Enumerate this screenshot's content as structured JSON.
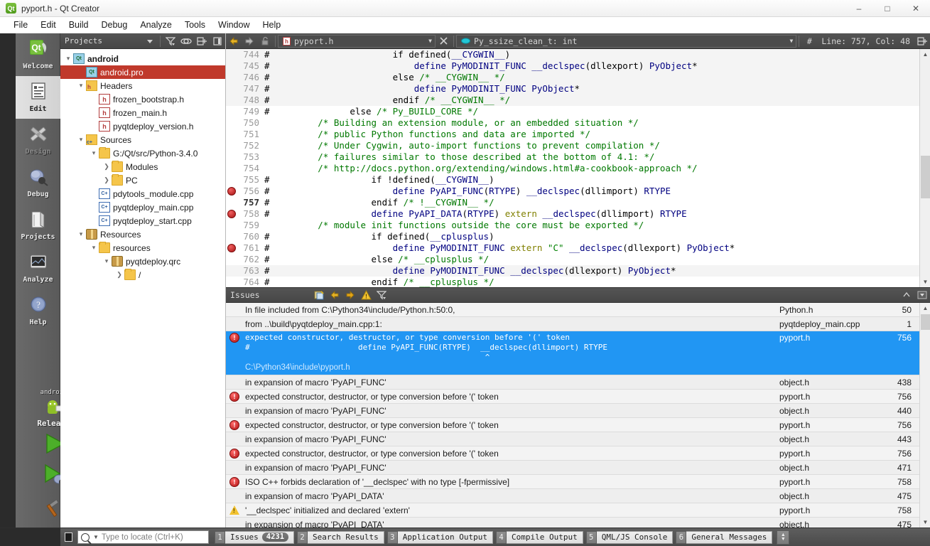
{
  "window": {
    "title": "pyport.h - Qt Creator",
    "app_icon": "qt-logo-icon",
    "minimize": "–",
    "maximize": "□",
    "close": "✕"
  },
  "menubar": {
    "items": [
      "File",
      "Edit",
      "Build",
      "Debug",
      "Analyze",
      "Tools",
      "Window",
      "Help"
    ]
  },
  "modebar": {
    "modes": [
      {
        "label": "Welcome",
        "icon": "qt-welcome-icon",
        "state": "normal"
      },
      {
        "label": "Edit",
        "icon": "document-edit-icon",
        "state": "active"
      },
      {
        "label": "Design",
        "icon": "design-ruler-pencil-icon",
        "state": "disabled"
      },
      {
        "label": "Debug",
        "icon": "bug-icon",
        "state": "normal"
      },
      {
        "label": "Projects",
        "icon": "projects-book-icon",
        "state": "normal"
      },
      {
        "label": "Analyze",
        "icon": "analyze-chart-icon",
        "state": "normal"
      },
      {
        "label": "Help",
        "icon": "help-question-icon",
        "state": "normal"
      }
    ],
    "kit": {
      "target": "android",
      "build_config": "Release",
      "selector_icon": "android-robot-icon",
      "run_icon": "run-green-arrow-icon",
      "debug_icon": "debug-start-icon",
      "build_icon": "build-hammer-icon"
    }
  },
  "projects_pane": {
    "title": "Projects",
    "toolbar_icons": [
      "filter-icon",
      "link-sync-icon",
      "split-add-icon",
      "close-sidebar-icon"
    ],
    "dropdown_icon": "chevron-down-icon",
    "tree": [
      {
        "depth": 0,
        "label": "android",
        "icon": "qt-project-icon",
        "arrow": "open",
        "bold": true,
        "selected": false
      },
      {
        "depth": 1,
        "label": "android.pro",
        "icon": "qt-project-icon",
        "arrow": "none",
        "bold": false,
        "selected": true
      },
      {
        "depth": 1,
        "label": "Headers",
        "icon": "folder-h-icon",
        "arrow": "open",
        "bold": false,
        "selected": false
      },
      {
        "depth": 2,
        "label": "frozen_bootstrap.h",
        "icon": "header-file-icon",
        "arrow": "none",
        "bold": false,
        "selected": false
      },
      {
        "depth": 2,
        "label": "frozen_main.h",
        "icon": "header-file-icon",
        "arrow": "none",
        "bold": false,
        "selected": false
      },
      {
        "depth": 2,
        "label": "pyqtdeploy_version.h",
        "icon": "header-file-icon",
        "arrow": "none",
        "bold": false,
        "selected": false
      },
      {
        "depth": 1,
        "label": "Sources",
        "icon": "folder-cpp-icon",
        "arrow": "open",
        "bold": false,
        "selected": false
      },
      {
        "depth": 2,
        "label": "G:/Qt/src/Python-3.4.0",
        "icon": "folder-icon",
        "arrow": "open",
        "bold": false,
        "selected": false
      },
      {
        "depth": 3,
        "label": "Modules",
        "icon": "folder-icon",
        "arrow": "closed",
        "bold": false,
        "selected": false
      },
      {
        "depth": 3,
        "label": "PC",
        "icon": "folder-icon",
        "arrow": "closed",
        "bold": false,
        "selected": false
      },
      {
        "depth": 2,
        "label": "pdytools_module.cpp",
        "icon": "cpp-file-icon",
        "arrow": "none",
        "bold": false,
        "selected": false
      },
      {
        "depth": 2,
        "label": "pyqtdeploy_main.cpp",
        "icon": "cpp-file-icon",
        "arrow": "none",
        "bold": false,
        "selected": false
      },
      {
        "depth": 2,
        "label": "pyqtdeploy_start.cpp",
        "icon": "cpp-file-icon",
        "arrow": "none",
        "bold": false,
        "selected": false
      },
      {
        "depth": 1,
        "label": "Resources",
        "icon": "resource-icon",
        "arrow": "open",
        "bold": false,
        "selected": false
      },
      {
        "depth": 2,
        "label": "resources",
        "icon": "folder-icon",
        "arrow": "open",
        "bold": false,
        "selected": false
      },
      {
        "depth": 3,
        "label": "pyqtdeploy.qrc",
        "icon": "resource-icon",
        "arrow": "open",
        "bold": false,
        "selected": false
      },
      {
        "depth": 4,
        "label": "/",
        "icon": "folder-icon",
        "arrow": "closed",
        "bold": false,
        "selected": false
      }
    ]
  },
  "editor_toolbar": {
    "back_icon": "arrow-back-icon",
    "forward_icon": "arrow-forward-icon",
    "lock_icon": "unlocked-padlock-icon",
    "file_icon": "header-file-icon",
    "filename": "pyport.h",
    "file_chevron": "chevron-down-icon",
    "close_icon": "close-x-icon",
    "symbol_icon": "symbol-variable-icon",
    "symbol": "Py_ssize_clean_t: int",
    "symbol_chevron": "chevron-down-icon",
    "hash_icon": "hash-icon",
    "cursor_position": "Line: 757, Col: 48",
    "split_icon": "split-add-icon"
  },
  "editor": {
    "lines": [
      {
        "n": "744",
        "bp": false,
        "shade": true,
        "text": "#                       if defined(__CYGWIN__)"
      },
      {
        "n": "745",
        "bp": false,
        "shade": true,
        "text": "#                           define PyMODINIT_FUNC __declspec(dllexport) PyObject*"
      },
      {
        "n": "746",
        "bp": false,
        "shade": true,
        "text": "#                       else /* __CYGWIN__ */"
      },
      {
        "n": "747",
        "bp": false,
        "shade": true,
        "text": "#                           define PyMODINIT_FUNC PyObject*"
      },
      {
        "n": "748",
        "bp": false,
        "shade": true,
        "text": "#                       endif /* __CYGWIN__ */"
      },
      {
        "n": "749",
        "bp": false,
        "shade": false,
        "text": "#               else /* Py_BUILD_CORE */"
      },
      {
        "n": "750",
        "bp": false,
        "shade": false,
        "text": "          /* Building an extension module, or an embedded situation */"
      },
      {
        "n": "751",
        "bp": false,
        "shade": false,
        "text": "          /* public Python functions and data are imported */"
      },
      {
        "n": "752",
        "bp": false,
        "shade": false,
        "text": "          /* Under Cygwin, auto-import functions to prevent compilation */"
      },
      {
        "n": "753",
        "bp": false,
        "shade": false,
        "text": "          /* failures similar to those described at the bottom of 4.1: */"
      },
      {
        "n": "754",
        "bp": false,
        "shade": false,
        "text": "          /* http://docs.python.org/extending/windows.html#a-cookbook-approach */"
      },
      {
        "n": "755",
        "bp": false,
        "shade": false,
        "text": "#                   if !defined(__CYGWIN__)"
      },
      {
        "n": "756",
        "bp": true,
        "shade": false,
        "text": "#                       define PyAPI_FUNC(RTYPE) __declspec(dllimport) RTYPE"
      },
      {
        "n": "757",
        "bp": false,
        "shade": false,
        "text": "#                   endif /* !__CYGWIN__ */",
        "current": true
      },
      {
        "n": "758",
        "bp": true,
        "shade": false,
        "text": "#                   define PyAPI_DATA(RTYPE) extern __declspec(dllimport) RTYPE"
      },
      {
        "n": "759",
        "bp": false,
        "shade": false,
        "text": "          /* module init functions outside the core must be exported */"
      },
      {
        "n": "760",
        "bp": false,
        "shade": false,
        "text": "#                   if defined(__cplusplus)"
      },
      {
        "n": "761",
        "bp": true,
        "shade": false,
        "text": "#                       define PyMODINIT_FUNC extern \"C\" __declspec(dllexport) PyObject*"
      },
      {
        "n": "762",
        "bp": false,
        "shade": false,
        "text": "#                   else /* __cplusplus */"
      },
      {
        "n": "763",
        "bp": false,
        "shade": true,
        "text": "#                       define PyMODINIT_FUNC __declspec(dllexport) PyObject*"
      },
      {
        "n": "764",
        "bp": false,
        "shade": false,
        "text": "#                   endif /* __cplusplus */"
      }
    ],
    "scroll_up_icon": "scroll-up-icon",
    "scroll_down_icon": "scroll-down-icon"
  },
  "issues_pane": {
    "title": "Issues",
    "toolbar_icons": [
      "copy-issue-icon",
      "previous-issue-icon",
      "next-issue-icon",
      "show-warnings-icon",
      "filter-icon"
    ],
    "maximize_icon": "chevron-up-icon",
    "hide_icon": "hide-pane-icon",
    "rows": [
      {
        "severity": "none",
        "desc": "In file included from C:\\Python34\\include/Python.h:50:0,",
        "file": "Python.h",
        "line": "50"
      },
      {
        "severity": "none",
        "desc": "from ..\\build\\pyqtdeploy_main.cpp:1:",
        "file": "pyqtdeploy_main.cpp",
        "line": "1"
      },
      {
        "severity": "error",
        "selected": true,
        "desc": "expected constructor, destructor, or type conversion before '(' token",
        "code_line": "#                       define PyAPI_FUNC(RTYPE)  __declspec(dllimport) RTYPE",
        "caret_line": "                                                   ^",
        "path": "C:\\Python34\\include\\pyport.h",
        "file": "pyport.h",
        "line": "756"
      },
      {
        "severity": "none",
        "desc": "in expansion of macro 'PyAPI_FUNC'",
        "file": "object.h",
        "line": "438"
      },
      {
        "severity": "error",
        "desc": "expected constructor, destructor, or type conversion before '(' token",
        "file": "pyport.h",
        "line": "756"
      },
      {
        "severity": "none",
        "desc": "in expansion of macro 'PyAPI_FUNC'",
        "file": "object.h",
        "line": "440"
      },
      {
        "severity": "error",
        "desc": "expected constructor, destructor, or type conversion before '(' token",
        "file": "pyport.h",
        "line": "756"
      },
      {
        "severity": "none",
        "desc": "in expansion of macro 'PyAPI_FUNC'",
        "file": "object.h",
        "line": "443"
      },
      {
        "severity": "error",
        "desc": "expected constructor, destructor, or type conversion before '(' token",
        "file": "pyport.h",
        "line": "756"
      },
      {
        "severity": "none",
        "desc": "in expansion of macro 'PyAPI_FUNC'",
        "file": "object.h",
        "line": "471"
      },
      {
        "severity": "error",
        "desc": "ISO C++ forbids declaration of '__declspec' with no type [-fpermissive]",
        "file": "pyport.h",
        "line": "758"
      },
      {
        "severity": "none",
        "desc": "in expansion of macro 'PyAPI_DATA'",
        "file": "object.h",
        "line": "475"
      },
      {
        "severity": "warning",
        "desc": "'__declspec' initialized and declared 'extern'",
        "file": "pyport.h",
        "line": "758"
      },
      {
        "severity": "none",
        "desc": "in expansion of macro 'PyAPI_DATA'",
        "file": "object.h",
        "line": "475"
      }
    ]
  },
  "statusbar": {
    "sidebar_toggle_icon": "toggle-sidebar-icon",
    "locator_placeholder": "Type to locate (Ctrl+K)",
    "locator_value": "",
    "search_icon": "search-icon",
    "output_tabs": [
      {
        "num": "1",
        "label": "Issues",
        "badge": "4231",
        "active": true
      },
      {
        "num": "2",
        "label": "Search Results",
        "badge": "",
        "active": false
      },
      {
        "num": "3",
        "label": "Application Output",
        "badge": "",
        "active": false
      },
      {
        "num": "4",
        "label": "Compile Output",
        "badge": "",
        "active": false
      },
      {
        "num": "5",
        "label": "QML/JS Console",
        "badge": "",
        "active": false
      },
      {
        "num": "6",
        "label": "General Messages",
        "badge": "",
        "active": false
      }
    ],
    "updown_icon": "updown-arrows-icon"
  },
  "colors": {
    "selection_blue": "#2196f3",
    "tree_selection_red": "#c0392b",
    "error_red": "#b31212",
    "warning_yellow": "#f2c230",
    "comment_green": "#007800",
    "keyword_olive": "#808000",
    "identifier_navy": "#000080"
  }
}
